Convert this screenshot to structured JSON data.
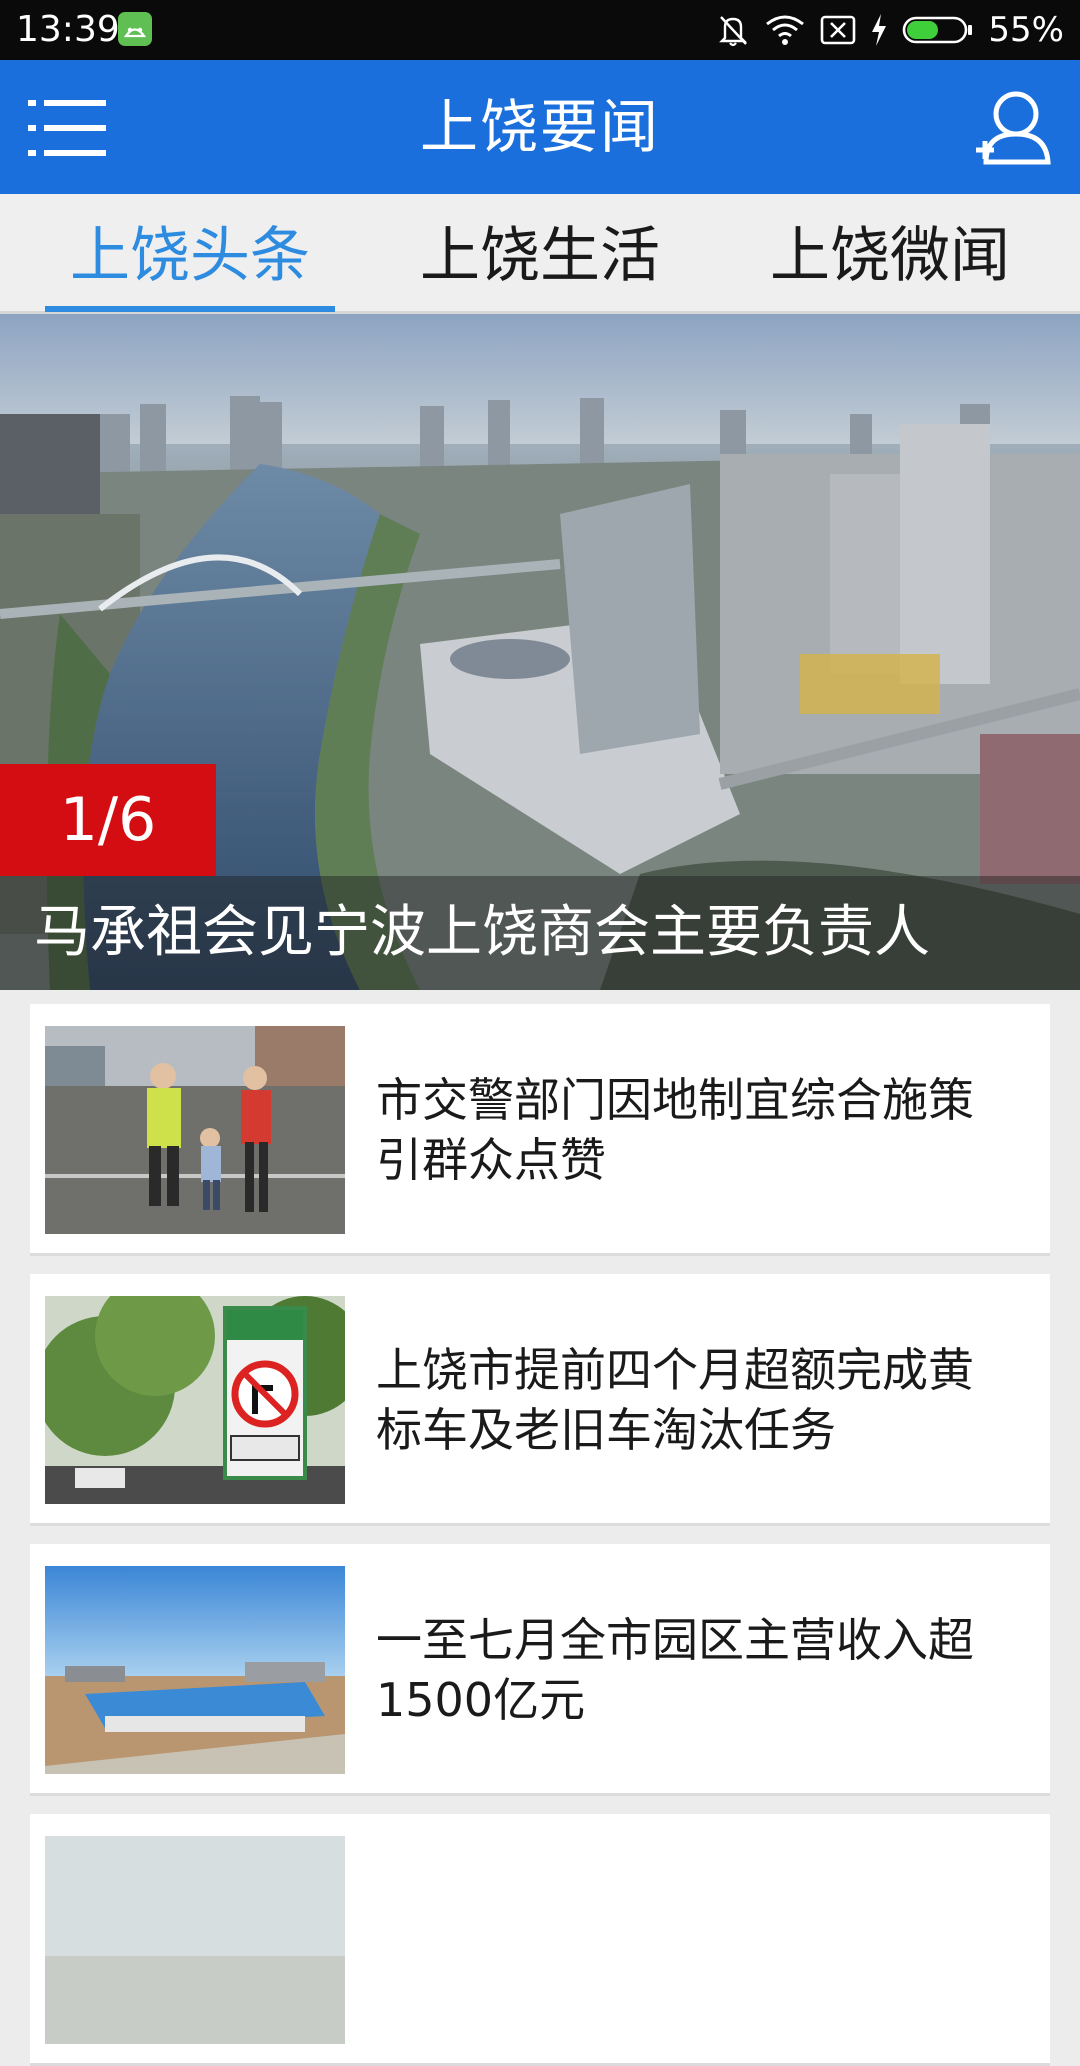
{
  "status_bar": {
    "time": "13:39",
    "battery_percent": "55%",
    "battery_level": 0.55,
    "icons": [
      "android-app-icon",
      "bell-muted-icon",
      "wifi-icon",
      "sim-off-icon",
      "charging-icon",
      "battery-icon"
    ]
  },
  "app_bar": {
    "title": "上饶要闻",
    "left_icon": "menu-list-icon",
    "right_icon": "user-icon",
    "color": "#1b6fdc"
  },
  "tabs": [
    {
      "label": "上饶头条",
      "active": true
    },
    {
      "label": "上饶生活",
      "active": false
    },
    {
      "label": "上饶微闻",
      "active": false
    }
  ],
  "banner": {
    "counter": "1/6",
    "caption": "马承祖会见宁波上饶商会主要负责人",
    "counter_color": "#d40d12"
  },
  "news": [
    {
      "title": "市交警部门因地制宜综合施策引群众点赞",
      "thumb": "traffic-police-photo"
    },
    {
      "title": "上饶市提前四个月超额完成黄标车及老旧车淘汰任务",
      "thumb": "road-sign-photo"
    },
    {
      "title": "一至七月全市园区主营收入超1500亿元",
      "thumb": "industrial-park-photo"
    },
    {
      "title": "",
      "thumb": "partial-photo"
    }
  ]
}
